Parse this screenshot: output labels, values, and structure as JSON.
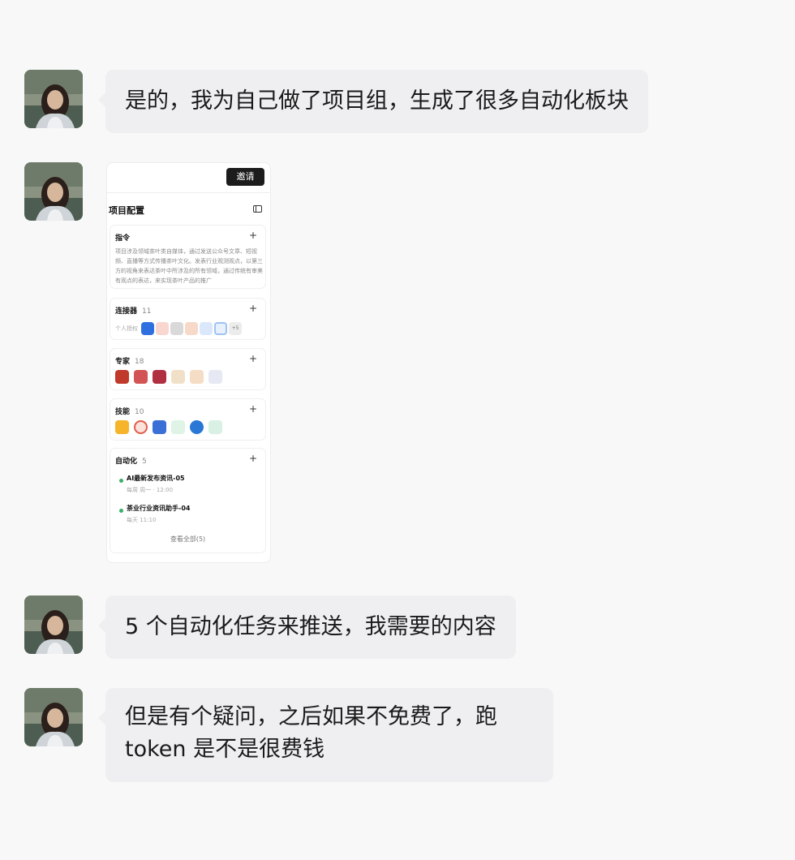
{
  "messages": [
    {
      "text": "是的，我为自己做了项目组，生成了很多自动化板块"
    },
    {
      "text": "5 个自动化任务来推送，我需要的内容"
    },
    {
      "text": "但是有个疑问，之后如果不免费了，跑 token 是不是很费钱"
    }
  ],
  "screenshot": {
    "invite_label": "邀请",
    "title": "项目配置",
    "instructions": {
      "heading": "指令",
      "text": "项目涉及领域茶叶类自媒体，通过发送公众号文章、短视频、直播等方式传播茶叶文化。发表行业观测观点，以第三方的视角来表达茶叶中所涉及的所有领域，通过传统有审美有观点的表达，来实现茶叶产品的推广"
    },
    "connectors": {
      "heading": "连接器",
      "count": "11",
      "label": "个人授权",
      "more": "+5"
    },
    "experts": {
      "heading": "专家",
      "count": "18"
    },
    "skills": {
      "heading": "技能",
      "count": "10"
    },
    "automation": {
      "heading": "自动化",
      "count": "5",
      "items": [
        {
          "name": "AI最新发布资讯-05",
          "schedule": "每周 周一 · 12:00"
        },
        {
          "name": "茶业行业资讯助手-04",
          "schedule": "每天 11:10"
        }
      ],
      "view_all": "查看全部(5)"
    }
  },
  "colors": {
    "background": "#f8f8f8",
    "bubble": "#efeff1",
    "status_dot": "#3ab06a"
  }
}
